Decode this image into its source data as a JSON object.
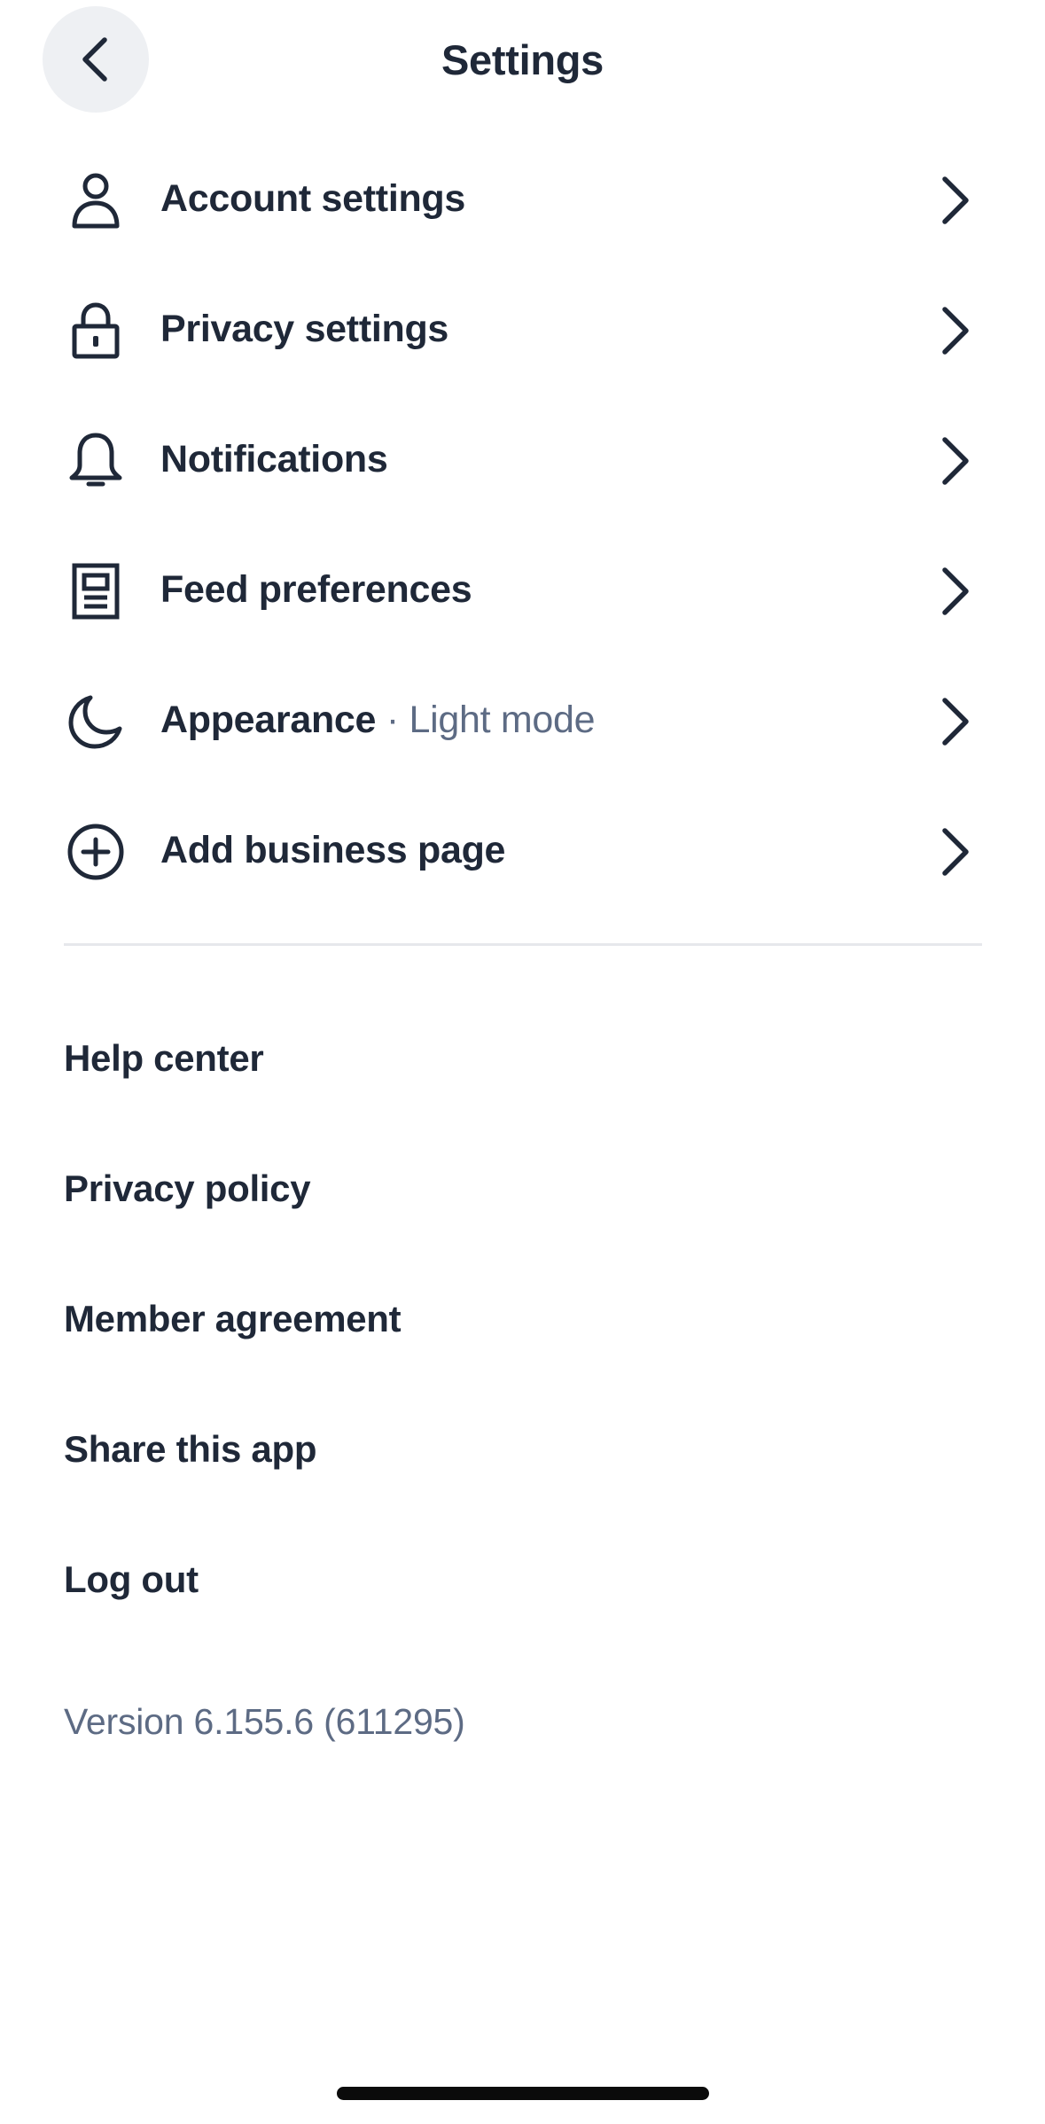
{
  "header": {
    "title": "Settings",
    "back_icon": "chevron-left-icon"
  },
  "settings_items": [
    {
      "icon": "person-icon",
      "label": "Account settings",
      "sub": ""
    },
    {
      "icon": "lock-icon",
      "label": "Privacy settings",
      "sub": ""
    },
    {
      "icon": "bell-icon",
      "label": "Notifications",
      "sub": ""
    },
    {
      "icon": "feed-icon",
      "label": "Feed preferences",
      "sub": ""
    },
    {
      "icon": "moon-icon",
      "label": "Appearance",
      "sub": " · Light mode"
    },
    {
      "icon": "plus-circle-icon",
      "label": "Add business page",
      "sub": ""
    }
  ],
  "links": [
    {
      "label": "Help center"
    },
    {
      "label": "Privacy policy"
    },
    {
      "label": "Member agreement"
    },
    {
      "label": "Share this app"
    },
    {
      "label": "Log out"
    }
  ],
  "footer": {
    "version": "Version 6.155.6 (611295)"
  },
  "colors": {
    "text_primary": "#1f2838",
    "text_secondary": "#5d6b84",
    "back_button_bg": "#eef0f3",
    "divider": "#e6e8ec"
  }
}
